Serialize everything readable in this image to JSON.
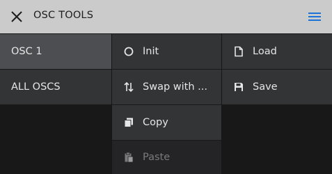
{
  "header": {
    "title": "OSC TOOLS",
    "accent_color": "#1a73d9"
  },
  "columns": {
    "targets": [
      {
        "label": "OSC 1"
      },
      {
        "label": "ALL OSCS"
      }
    ],
    "actions": [
      {
        "label": "Init",
        "icon": "circle-icon"
      },
      {
        "label": "Swap with ...",
        "icon": "swap-icon"
      },
      {
        "label": "Copy",
        "icon": "copy-icon"
      },
      {
        "label": "Paste",
        "icon": "paste-icon"
      }
    ],
    "file": [
      {
        "label": "Load",
        "icon": "file-icon"
      },
      {
        "label": "Save",
        "icon": "save-icon"
      }
    ]
  }
}
